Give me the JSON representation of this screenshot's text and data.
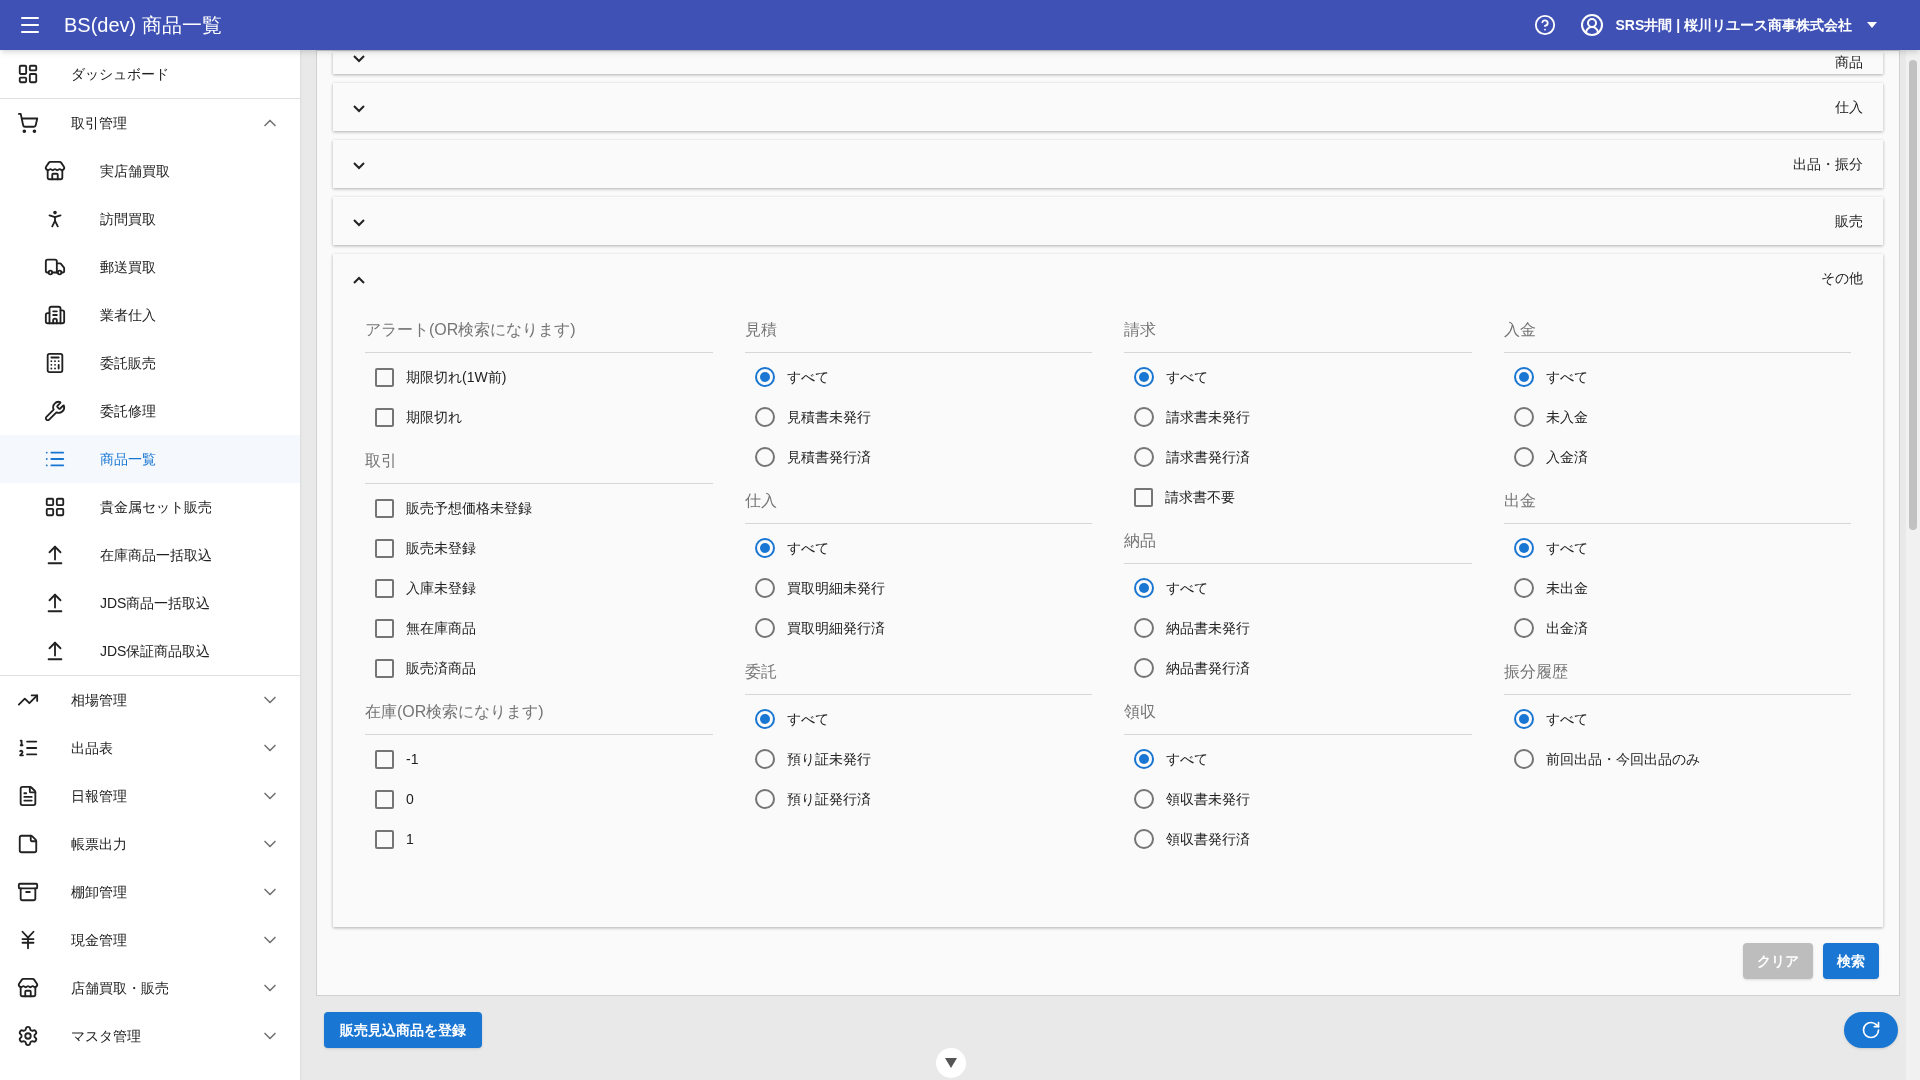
{
  "header": {
    "title": "BS(dev) 商品一覧",
    "user": "SRS井間 | 桜川リユース商事株式会社"
  },
  "sidebar": {
    "items": [
      {
        "label": "ダッシュボード",
        "selected": false
      },
      {
        "label": "取引管理",
        "selected": false,
        "expanded": true,
        "children": [
          {
            "label": "実店舗買取",
            "selected": false
          },
          {
            "label": "訪問買取",
            "selected": false
          },
          {
            "label": "郵送買取",
            "selected": false
          },
          {
            "label": "業者仕入",
            "selected": false
          },
          {
            "label": "委託販売",
            "selected": false
          },
          {
            "label": "委託修理",
            "selected": false
          },
          {
            "label": "商品一覧",
            "selected": true
          },
          {
            "label": "貴金属セット販売",
            "selected": false
          },
          {
            "label": "在庫商品一括取込",
            "selected": false
          },
          {
            "label": "JDS商品一括取込",
            "selected": false
          },
          {
            "label": "JDS保証商品取込",
            "selected": false
          }
        ]
      },
      {
        "label": "相場管理",
        "selected": false,
        "expanded": false
      },
      {
        "label": "出品表",
        "selected": false,
        "expanded": false
      },
      {
        "label": "日報管理",
        "selected": false,
        "expanded": false
      },
      {
        "label": "帳票出力",
        "selected": false,
        "expanded": false
      },
      {
        "label": "棚卸管理",
        "selected": false,
        "expanded": false
      },
      {
        "label": "現金管理",
        "selected": false,
        "expanded": false
      },
      {
        "label": "店舗買取・販売",
        "selected": false,
        "expanded": false
      },
      {
        "label": "マスタ管理",
        "selected": false,
        "expanded": false
      }
    ]
  },
  "accordions": [
    {
      "title": "商品",
      "expanded": false
    },
    {
      "title": "仕入",
      "expanded": false
    },
    {
      "title": "出品・振分",
      "expanded": false
    },
    {
      "title": "販売",
      "expanded": false
    },
    {
      "title": "その他",
      "expanded": true
    }
  ],
  "filters": {
    "columns": [
      [
        {
          "title": "アラート(OR検索になります)",
          "options": [
            {
              "kind": "checkbox",
              "label": "期限切れ(1W前)",
              "checked": false
            },
            {
              "kind": "checkbox",
              "label": "期限切れ",
              "checked": false
            }
          ]
        },
        {
          "title": "取引",
          "options": [
            {
              "kind": "checkbox",
              "label": "販売予想価格未登録",
              "checked": false
            },
            {
              "kind": "checkbox",
              "label": "販売未登録",
              "checked": false
            },
            {
              "kind": "checkbox",
              "label": "入庫未登録",
              "checked": false
            },
            {
              "kind": "checkbox",
              "label": "無在庫商品",
              "checked": false
            },
            {
              "kind": "checkbox",
              "label": "販売済商品",
              "checked": false
            }
          ]
        },
        {
          "title": "在庫(OR検索になります)",
          "options": [
            {
              "kind": "checkbox",
              "label": "-1",
              "checked": false
            },
            {
              "kind": "checkbox",
              "label": "0",
              "checked": false
            },
            {
              "kind": "checkbox",
              "label": "1",
              "checked": false
            }
          ]
        }
      ],
      [
        {
          "title": "見積",
          "options": [
            {
              "kind": "radio",
              "label": "すべて",
              "selected": true
            },
            {
              "kind": "radio",
              "label": "見積書未発行",
              "selected": false
            },
            {
              "kind": "radio",
              "label": "見積書発行済",
              "selected": false
            }
          ]
        },
        {
          "title": "仕入",
          "options": [
            {
              "kind": "radio",
              "label": "すべて",
              "selected": true
            },
            {
              "kind": "radio",
              "label": "買取明細未発行",
              "selected": false
            },
            {
              "kind": "radio",
              "label": "買取明細発行済",
              "selected": false
            }
          ]
        },
        {
          "title": "委託",
          "options": [
            {
              "kind": "radio",
              "label": "すべて",
              "selected": true
            },
            {
              "kind": "radio",
              "label": "預り証未発行",
              "selected": false
            },
            {
              "kind": "radio",
              "label": "預り証発行済",
              "selected": false
            }
          ]
        }
      ],
      [
        {
          "title": "請求",
          "options": [
            {
              "kind": "radio",
              "label": "すべて",
              "selected": true
            },
            {
              "kind": "radio",
              "label": "請求書未発行",
              "selected": false
            },
            {
              "kind": "radio",
              "label": "請求書発行済",
              "selected": false
            },
            {
              "kind": "checkbox",
              "label": "請求書不要",
              "checked": false
            }
          ]
        },
        {
          "title": "納品",
          "options": [
            {
              "kind": "radio",
              "label": "すべて",
              "selected": true
            },
            {
              "kind": "radio",
              "label": "納品書未発行",
              "selected": false
            },
            {
              "kind": "radio",
              "label": "納品書発行済",
              "selected": false
            }
          ]
        },
        {
          "title": "領収",
          "options": [
            {
              "kind": "radio",
              "label": "すべて",
              "selected": true
            },
            {
              "kind": "radio",
              "label": "領収書未発行",
              "selected": false
            },
            {
              "kind": "radio",
              "label": "領収書発行済",
              "selected": false
            }
          ]
        }
      ],
      [
        {
          "title": "入金",
          "options": [
            {
              "kind": "radio",
              "label": "すべて",
              "selected": true
            },
            {
              "kind": "radio",
              "label": "未入金",
              "selected": false
            },
            {
              "kind": "radio",
              "label": "入金済",
              "selected": false
            }
          ]
        },
        {
          "title": "出金",
          "options": [
            {
              "kind": "radio",
              "label": "すべて",
              "selected": true
            },
            {
              "kind": "radio",
              "label": "未出金",
              "selected": false
            },
            {
              "kind": "radio",
              "label": "出金済",
              "selected": false
            }
          ]
        },
        {
          "title": "振分履歴",
          "options": [
            {
              "kind": "radio",
              "label": "すべて",
              "selected": true
            },
            {
              "kind": "radio",
              "label": "前回出品・今回出品のみ",
              "selected": false
            }
          ]
        }
      ]
    ]
  },
  "actions": {
    "clear": {
      "label": "クリア",
      "disabled": true
    },
    "search": {
      "label": "検索",
      "disabled": false
    }
  },
  "register_button": "販売見込商品を登録"
}
